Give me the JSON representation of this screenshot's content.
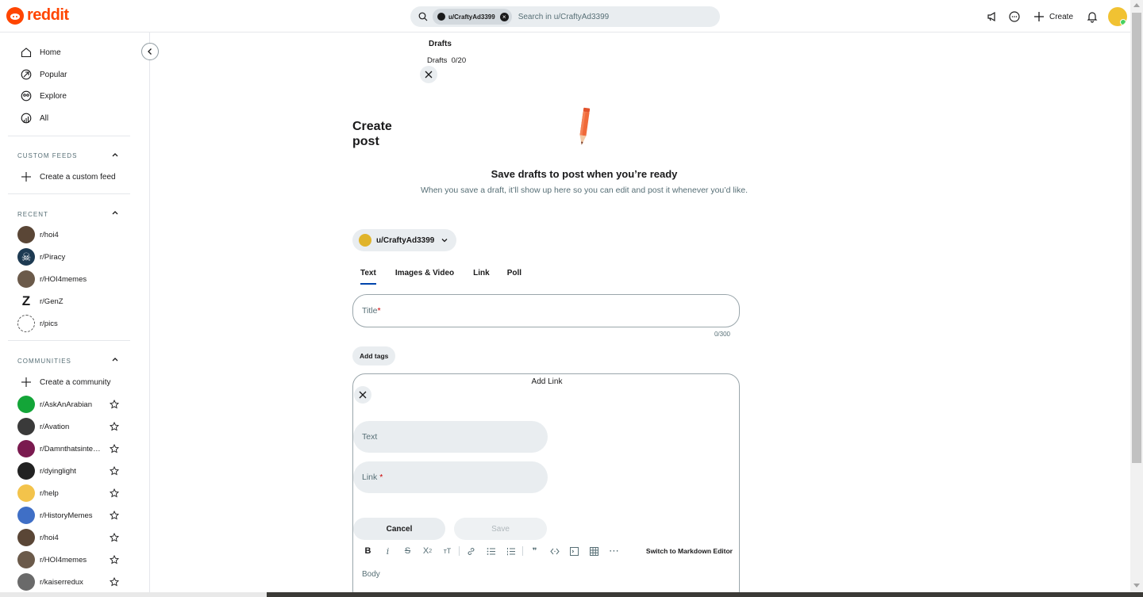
{
  "header": {
    "brand": "reddit",
    "search": {
      "chip_label": "u/CraftyAd3399",
      "placeholder": "Search in u/CraftyAd3399"
    },
    "create_label": "Create"
  },
  "sidebar": {
    "nav": [
      {
        "label": "Home",
        "icon": "home-icon"
      },
      {
        "label": "Popular",
        "icon": "popular-icon"
      },
      {
        "label": "Explore",
        "icon": "explore-icon"
      },
      {
        "label": "All",
        "icon": "all-icon"
      }
    ],
    "custom_feeds": {
      "title": "CUSTOM FEEDS",
      "create_label": "Create a custom feed"
    },
    "recent": {
      "title": "RECENT",
      "items": [
        {
          "label": "r/hoi4",
          "color": "#5a4636"
        },
        {
          "label": "r/Piracy",
          "color": "#1d3a52"
        },
        {
          "label": "r/HOI4memes",
          "color": "#6b5a4a"
        },
        {
          "label": "r/GenZ",
          "color": "#ffffff"
        },
        {
          "label": "r/pics",
          "color": "#ffffff"
        }
      ]
    },
    "communities": {
      "title": "COMMUNITIES",
      "create_label": "Create a community",
      "items": [
        {
          "label": "r/AskAnArabian",
          "color": "#13a538"
        },
        {
          "label": "r/Avation",
          "color": "#3a3a3a"
        },
        {
          "label": "r/Damnthatsinteresting",
          "color": "#7a1a4f"
        },
        {
          "label": "r/dyinglight",
          "color": "#222222"
        },
        {
          "label": "r/help",
          "color": "#f3c34b"
        },
        {
          "label": "r/HistoryMemes",
          "color": "#3f6fc6"
        },
        {
          "label": "r/hoi4",
          "color": "#5a4636"
        },
        {
          "label": "r/HOI4memes",
          "color": "#6b5a4a"
        },
        {
          "label": "r/kaiserredux",
          "color": "#6a6a6a"
        }
      ]
    }
  },
  "drafts": {
    "title": "Drafts",
    "label": "Drafts",
    "count": "0/20",
    "empty_heading": "Save drafts to post when you’re ready",
    "empty_desc": "When you save a draft, it’ll show up here so you can edit and post it whenever you’d like."
  },
  "post": {
    "page_title": "Create post",
    "community": "u/CraftyAd3399",
    "tabs": [
      "Text",
      "Images & Video",
      "Link",
      "Poll"
    ],
    "active_tab": "Text",
    "title_placeholder": "Title",
    "title_required_mark": "*",
    "title_counter": "0/300",
    "add_tags": "Add tags",
    "editor": {
      "add_link_title": "Add Link",
      "text_placeholder": "Text",
      "link_placeholder": "Link",
      "link_required_mark": "*",
      "cancel": "Cancel",
      "save": "Save",
      "markdown_switch": "Switch to Markdown Editor",
      "body_placeholder": "Body",
      "toolbar": [
        {
          "name": "bold-icon",
          "glyph": "B"
        },
        {
          "name": "italic-icon",
          "glyph": "i"
        },
        {
          "name": "strikethrough-icon",
          "glyph": "S"
        },
        {
          "name": "superscript-icon",
          "glyph": "X²"
        },
        {
          "name": "heading-icon",
          "glyph": "ᴛT"
        },
        {
          "name": "link-icon",
          "glyph": "🔗"
        },
        {
          "name": "bullet-list-icon",
          "glyph": "☰"
        },
        {
          "name": "numbered-list-icon",
          "glyph": "☷"
        },
        {
          "name": "quote-icon",
          "glyph": "99"
        },
        {
          "name": "code-icon",
          "glyph": "‹›"
        },
        {
          "name": "code-block-icon",
          "glyph": "▣"
        },
        {
          "name": "table-icon",
          "glyph": "⊞"
        },
        {
          "name": "more-icon",
          "glyph": "⋯"
        }
      ]
    }
  }
}
